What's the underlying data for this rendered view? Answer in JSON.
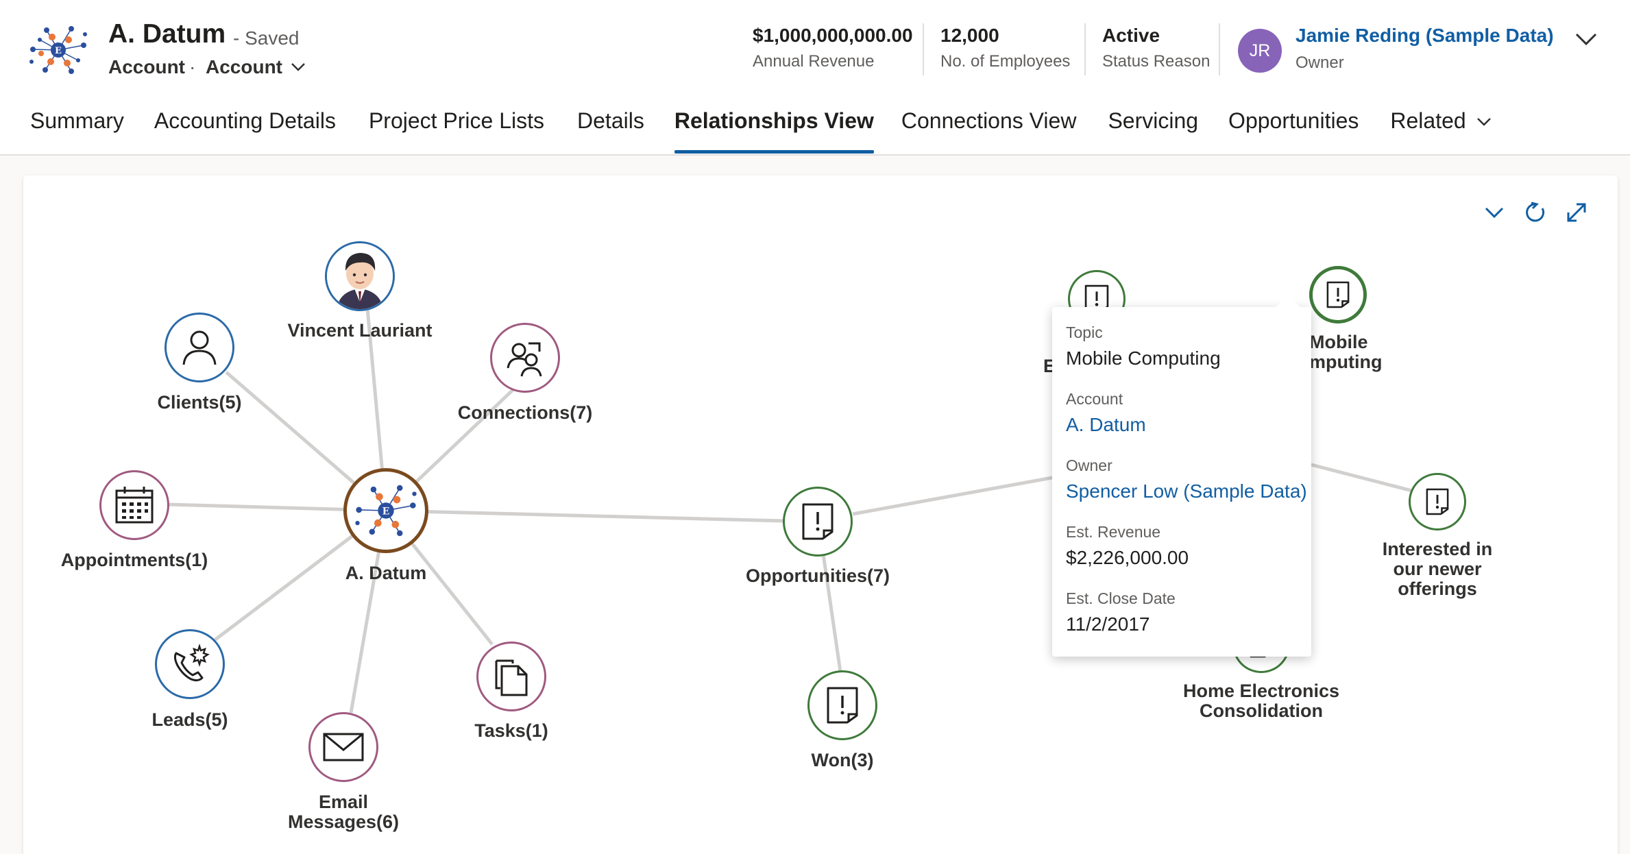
{
  "record": {
    "title": "A. Datum",
    "saved_status": "- Saved",
    "entity": "Account",
    "separator": "·",
    "form_name": "Account"
  },
  "header_fields": [
    {
      "value": "$1,000,000,000.00",
      "label": "Annual Revenue"
    },
    {
      "value": "12,000",
      "label": "No. of Employees"
    },
    {
      "value": "Active",
      "label": "Status Reason"
    }
  ],
  "owner": {
    "initials": "JR",
    "name": "Jamie Reding (Sample Data)",
    "label": "Owner",
    "avatar_color": "#8764b8"
  },
  "tabs": [
    {
      "label": "Summary"
    },
    {
      "label": "Accounting Details"
    },
    {
      "label": "Project Price Lists"
    },
    {
      "label": "Details"
    },
    {
      "label": "Relationships View",
      "active": true
    },
    {
      "label": "Connections View"
    },
    {
      "label": "Servicing"
    },
    {
      "label": "Opportunities"
    },
    {
      "label": "Related",
      "dropdown": true
    }
  ],
  "graph": {
    "center": {
      "label": "A. Datum",
      "icon": "account-logo-icon"
    },
    "nodes": [
      {
        "id": "vincent",
        "label": "Vincent Lauriant",
        "icon": "contact-photo-icon"
      },
      {
        "id": "clients",
        "label": "Clients(5)",
        "icon": "person-icon"
      },
      {
        "id": "connections",
        "label": "Connections(7)",
        "icon": "people-icon"
      },
      {
        "id": "appointments",
        "label": "Appointments(1)",
        "icon": "calendar-icon"
      },
      {
        "id": "leads",
        "label": "Leads(5)",
        "icon": "phone-icon"
      },
      {
        "id": "email",
        "label_line1": "Email",
        "label_line2": "Messages(6)",
        "icon": "envelope-icon"
      },
      {
        "id": "tasks",
        "label": "Tasks(1)",
        "icon": "tasks-icon"
      },
      {
        "id": "opportunities",
        "label": "Opportunities(7)",
        "icon": "opportunity-icon"
      },
      {
        "id": "won",
        "label": "Won(3)",
        "icon": "opportunity-icon"
      },
      {
        "id": "opp-partial-left",
        "label": "En",
        "icon": "opportunity-icon"
      },
      {
        "id": "mobile-computing",
        "label_line1": "Mobile",
        "label_line2": "mputing",
        "icon": "opportunity-icon"
      },
      {
        "id": "interested",
        "label_line1": "Interested in",
        "label_line2": "our newer",
        "label_line3": "offerings",
        "icon": "opportunity-icon"
      },
      {
        "id": "home-electronics",
        "label_line1": "Home Electronics",
        "label_line2": "Consolidation",
        "icon": "opportunity-icon"
      }
    ]
  },
  "tooltip": {
    "topic_label": "Topic",
    "topic": "Mobile Computing",
    "account_label": "Account",
    "account": "A. Datum",
    "owner_label": "Owner",
    "owner": "Spencer Low (Sample Data)",
    "revenue_label": "Est. Revenue",
    "revenue": "$2,226,000.00",
    "close_label": "Est. Close Date",
    "close": "11/2/2017"
  },
  "colors": {
    "accent": "#115ea3",
    "edge": "#d2d0ce",
    "node_blue": "#2b6aa8",
    "node_pink": "#a05a80",
    "node_green": "#3f7a3b"
  }
}
